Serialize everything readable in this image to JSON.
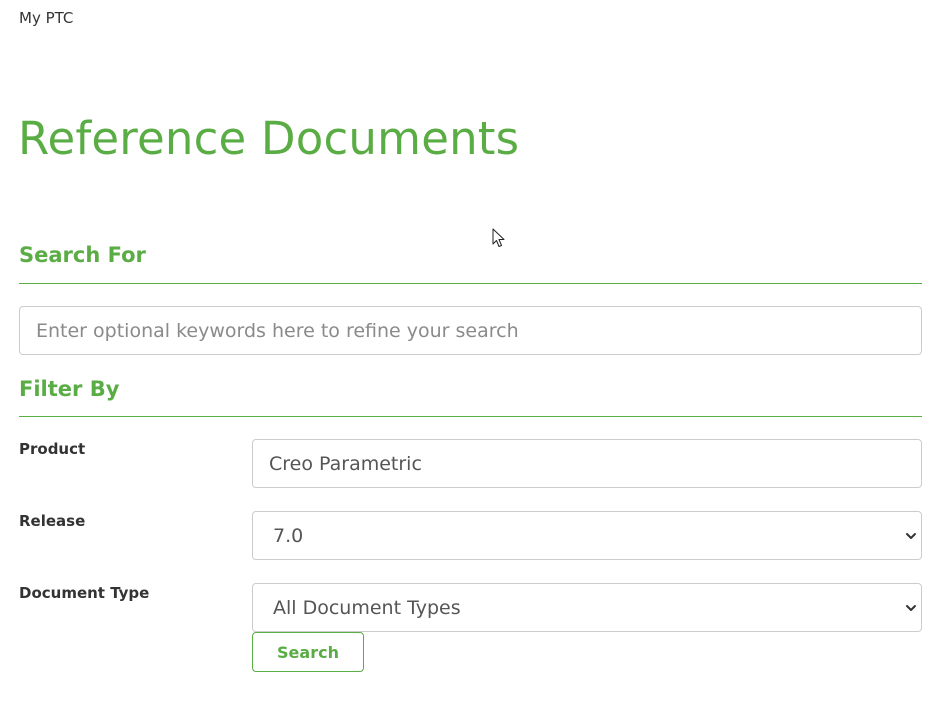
{
  "breadcrumb": {
    "label": "My PTC"
  },
  "page": {
    "title": "Reference Documents"
  },
  "search_section": {
    "heading": "Search For",
    "keyword_input": {
      "value": "",
      "placeholder": "Enter optional keywords here to refine your search"
    }
  },
  "filter_section": {
    "heading": "Filter By",
    "product": {
      "label": "Product",
      "value": "Creo Parametric"
    },
    "release": {
      "label": "Release",
      "selected": "7.0"
    },
    "document_type": {
      "label": "Document Type",
      "selected": "All Document Types"
    },
    "search_button": {
      "label": "Search"
    }
  },
  "colors": {
    "accent": "#5aac44",
    "text": "#333333",
    "border": "#cccccc",
    "placeholder": "#8a8a8a"
  },
  "icons": {
    "select_arrow": "chevron-down-icon",
    "pointer": "mouse-cursor-icon"
  }
}
